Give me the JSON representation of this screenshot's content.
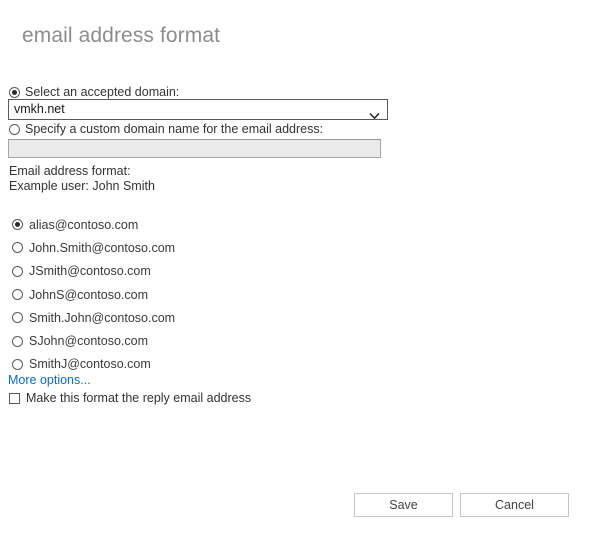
{
  "page": {
    "title": "email address format"
  },
  "domain": {
    "accepted_domain_label": "Select an accepted domain:",
    "accepted_domain_selected": true,
    "accepted_domain_value": "vmkh.net",
    "accepted_domain_options": [
      "vmkh.net"
    ],
    "select_chevron_icon": "chevron-down-icon",
    "custom_domain_label": "Specify a custom domain name for the email address:",
    "custom_domain_selected": false,
    "custom_domain_value": "",
    "custom_domain_placeholder": ""
  },
  "format_section": {
    "heading": "Email address format:",
    "example_user": "Example user: John Smith",
    "options": [
      {
        "label": "alias@contoso.com",
        "selected": true
      },
      {
        "label": "John.Smith@contoso.com",
        "selected": false
      },
      {
        "label": "JSmith@contoso.com",
        "selected": false
      },
      {
        "label": "JohnS@contoso.com",
        "selected": false
      },
      {
        "label": "Smith.John@contoso.com",
        "selected": false
      },
      {
        "label": "SJohn@contoso.com",
        "selected": false
      },
      {
        "label": "SmithJ@contoso.com",
        "selected": false
      }
    ],
    "more_options_label": "More options...",
    "reply_address_label": "Make this format the reply email address",
    "reply_address_checked": false
  },
  "footer": {
    "save_label": "Save",
    "cancel_label": "Cancel"
  },
  "colors": {
    "link": "#0f6cbd",
    "title": "#8d8d8d",
    "text": "#333333",
    "disabled_field_bg": "#eaeaea",
    "background": "#ffffff"
  }
}
